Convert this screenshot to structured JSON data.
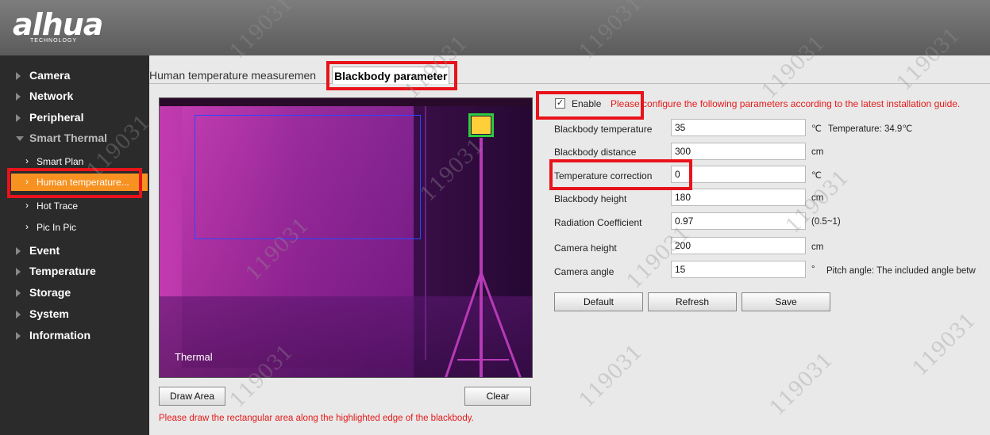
{
  "header": {
    "logo": "alhua",
    "logo_sub": "TECHNOLOGY"
  },
  "sidebar": {
    "items": [
      {
        "label": "Camera"
      },
      {
        "label": "Network"
      },
      {
        "label": "Peripheral"
      },
      {
        "label": "Smart Thermal"
      },
      {
        "label": "Event"
      },
      {
        "label": "Temperature"
      },
      {
        "label": "Storage"
      },
      {
        "label": "System"
      },
      {
        "label": "Information"
      }
    ],
    "sub_items": [
      {
        "label": "Smart Plan"
      },
      {
        "label": "Human temperature..."
      },
      {
        "label": "Hot Trace"
      },
      {
        "label": "Pic In Pic"
      }
    ]
  },
  "tabs": [
    {
      "label": "Human temperature measuremen"
    },
    {
      "label": "Blackbody parameter"
    }
  ],
  "video": {
    "label": "Thermal",
    "draw_area_label": "Draw Area",
    "clear_label": "Clear",
    "hint": "Please draw the rectangular area along the highlighted edge of the blackbody."
  },
  "form": {
    "enable_label": "Enable",
    "enable_checked": true,
    "enable_note": "Please configure the following parameters according to the latest installation guide.",
    "fields": [
      {
        "label": "Blackbody temperature",
        "value": "35",
        "unit": "℃",
        "extra": "Temperature: 34.9℃"
      },
      {
        "label": "Blackbody distance",
        "value": "300",
        "unit": "cm"
      },
      {
        "label": "Temperature correction",
        "value": "0",
        "unit": "℃"
      },
      {
        "label": "Blackbody height",
        "value": "180",
        "unit": "cm"
      },
      {
        "label": "Radiation Coefficient",
        "value": "0.97",
        "unit": "(0.5~1)"
      },
      {
        "label": "Camera height",
        "value": "200",
        "unit": "cm"
      },
      {
        "label": "Camera angle",
        "value": "15",
        "unit": "°",
        "extra": "Pitch angle: The included angle betw"
      }
    ],
    "buttons": {
      "default": "Default",
      "refresh": "Refresh",
      "save": "Save"
    }
  },
  "watermark": "119031",
  "colors": {
    "accent": "#f79221",
    "highlight": "#e8131b",
    "sidebar_bg": "#2b2b2b"
  }
}
